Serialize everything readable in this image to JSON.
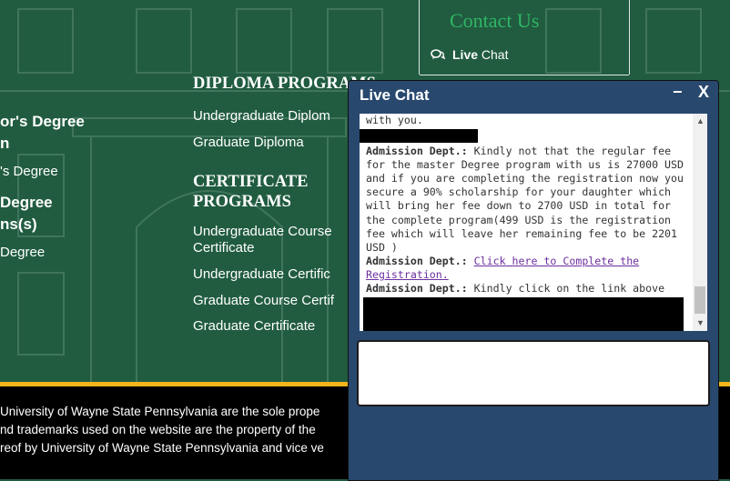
{
  "left_column": {
    "heading_1": [
      "or's Degree",
      "n"
    ],
    "item_1": "'s Degree",
    "heading_2": [
      "Degree",
      "ns(s)"
    ],
    "item_2": "Degree"
  },
  "diploma": {
    "heading": "DIPLOMA PROGRAMS",
    "items": [
      "Undergraduate Diplom",
      "Graduate Diploma"
    ]
  },
  "certificate": {
    "heading": [
      "CERTIFICATE",
      "PROGRAMS"
    ],
    "items": [
      "Undergraduate Course",
      "Certificate",
      "Undergraduate Certific",
      "Graduate Course Certif",
      "Graduate Certificate"
    ]
  },
  "contact": {
    "title": "Contact Us",
    "live_chat_bold": "Live",
    "live_chat_rest": "Chat"
  },
  "footer": {
    "lines": [
      "University of Wayne State Pennsylvania are the sole prope",
      "nd trademarks used on the website are the property of the",
      "reof by University of Wayne State Pennsylvania and vice ve"
    ]
  },
  "chat": {
    "title": "Live Chat",
    "minimize": "−",
    "close": "X",
    "messages": [
      {
        "text": "with you."
      },
      {
        "who": "Admission Dept.:",
        "text": " Kindly not that the regular fee for the master Degree program with us is 27000 USD and if you are completing the registration now you secure a 90% scholarship for your daughter which will bring her fee down to 2700 USD in total for the complete program(499 USD is the registration fee which will leave her remaining fee to be 2201 USD )"
      },
      {
        "who": "Admission Dept.:",
        "link": "Click here to Complete the Registration."
      },
      {
        "who": "Admission Dept.:",
        "text": " Kindly click on the link above"
      }
    ],
    "input_value": ""
  },
  "colors": {
    "page_green": "#215c40",
    "gold": "#f2b51c",
    "chat_blue": "#28486e",
    "contact_green": "#2fb564",
    "link_purple": "#6b2fa0"
  }
}
